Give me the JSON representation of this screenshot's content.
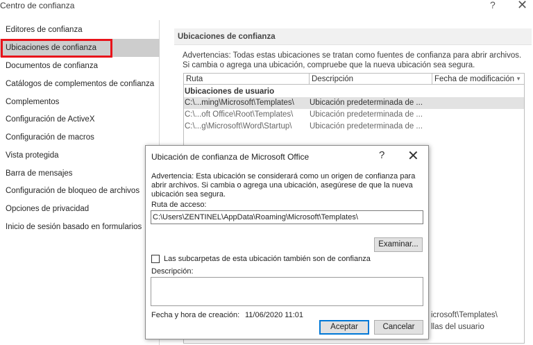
{
  "window": {
    "title": "Centro de confianza",
    "help": "?",
    "close": "✕"
  },
  "sidebar": {
    "items": [
      {
        "label": "Editores de confianza"
      },
      {
        "label": "Ubicaciones de confianza"
      },
      {
        "label": "Documentos de confianza"
      },
      {
        "label": "Catálogos de complementos de confianza"
      },
      {
        "label": "Complementos"
      },
      {
        "label": "Configuración de ActiveX"
      },
      {
        "label": "Configuración de macros"
      },
      {
        "label": "Vista protegida"
      },
      {
        "label": "Barra de mensajes"
      },
      {
        "label": "Configuración de bloqueo de archivos"
      },
      {
        "label": "Opciones de privacidad"
      },
      {
        "label": "Inicio de sesión basado en formularios"
      }
    ]
  },
  "main": {
    "section_title": "Ubicaciones de confianza",
    "warning": "Advertencias: Todas estas ubicaciones se tratan como fuentes de confianza para abrir archivos. Si cambia o agrega una ubicación, compruebe que la nueva ubicación sea segura.",
    "table": {
      "columns": [
        "Ruta",
        "Descripción",
        "Fecha de modificación"
      ],
      "sort_icon": "▼",
      "group_user": "Ubicaciones de usuario",
      "rows": [
        {
          "path": "C:\\...ming\\Microsoft\\Templates\\",
          "desc": "Ubicación predeterminada de ..."
        },
        {
          "path": "C:\\...oft Office\\Root\\Templates\\",
          "desc": "Ubicación predeterminada de ..."
        },
        {
          "path": "C:\\...g\\Microsoft\\Word\\Startup\\",
          "desc": "Ubicación predeterminada de ..."
        }
      ]
    },
    "behind_text_1": "icrosoft\\Templates\\",
    "behind_text_2": "llas del usuario"
  },
  "dialog": {
    "title": "Ubicación de confianza de Microsoft Office",
    "help": "?",
    "close": "✕",
    "warning": "Advertencia: Esta ubicación se considerará como un origen de confianza para abrir archivos. Si cambia o agrega una ubicación, asegúrese de que la nueva ubicación sea segura.",
    "path_label": "Ruta de acceso:",
    "path_value": "C:\\Users\\ZENTINEL\\AppData\\Roaming\\Microsoft\\Templates\\",
    "browse_label": "Examinar...",
    "subfolders_label": "Las subcarpetas de esta ubicación también son de confianza",
    "description_label": "Descripción:",
    "description_value": "",
    "date_label": "Fecha y hora de creación:",
    "date_value": "11/06/2020 11:01",
    "accept_label": "Aceptar",
    "cancel_label": "Cancelar"
  }
}
